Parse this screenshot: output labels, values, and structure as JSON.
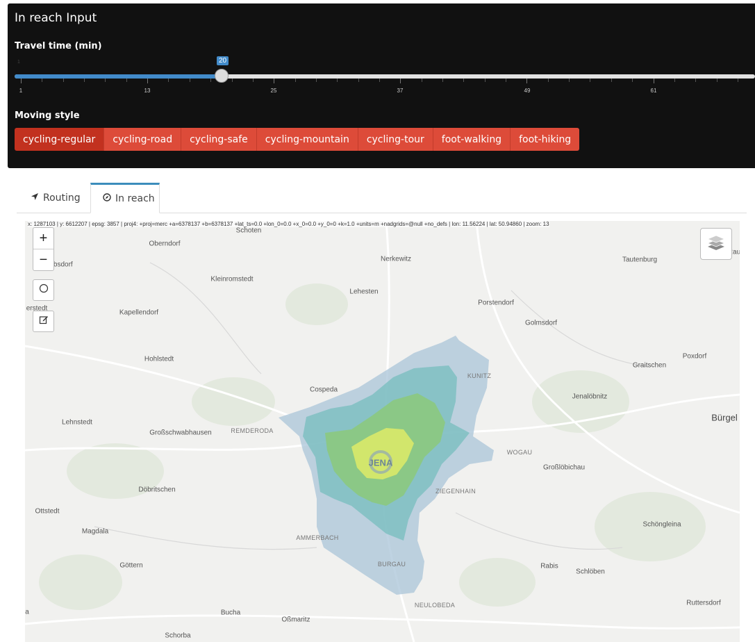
{
  "input_panel": {
    "title": "In reach Input",
    "travel_time_label": "Travel time (min)",
    "slider": {
      "min": 1,
      "value": 20,
      "min_label": "1",
      "value_label": "20",
      "tick_labels": [
        "1",
        "13",
        "25",
        "37",
        "49",
        "61"
      ]
    },
    "moving_style_label": "Moving style",
    "moving_styles": [
      {
        "label": "cycling-regular",
        "active": true
      },
      {
        "label": "cycling-road",
        "active": false
      },
      {
        "label": "cycling-safe",
        "active": false
      },
      {
        "label": "cycling-mountain",
        "active": false
      },
      {
        "label": "cycling-tour",
        "active": false
      },
      {
        "label": "foot-walking",
        "active": false
      },
      {
        "label": "foot-hiking",
        "active": false
      }
    ]
  },
  "tabs": [
    {
      "label": "Routing",
      "icon": "location-arrow-icon",
      "active": false
    },
    {
      "label": "In reach",
      "icon": "compass-icon",
      "active": true
    }
  ],
  "map": {
    "coord_readout": "x: 1287103 | y: 6612207 | epsg: 3857 | proj4: +proj=merc +a=6378137 +b=6378137 +lat_ts=0.0 +lon_0=0.0 +x_0=0.0 +y_0=0 +k=1.0 +units=m +nadgrids=@null +no_defs | lon: 11.56224 | lat: 50.94860 | zoom: 13",
    "zoom_in": "+",
    "zoom_out": "−",
    "center_label": "JENA",
    "places": {
      "schoten": "Schoten",
      "oberndorf": "Oberndorf",
      "nerkewitz": "Nerkewitz",
      "tautenburg": "Tautenburg",
      "absdorf": "absdorf",
      "kleinromstedt": "Kleinromstedt",
      "lehesten": "Lehesten",
      "porstendorf": "Porstendorf",
      "golmsdorf": "Golmsdorf",
      "erstedt": "erstedt",
      "kapellendorf": "Kapellendorf",
      "hohlstedt": "Hohlstedt",
      "kunitz": "KUNITZ",
      "graitschen": "Graitschen",
      "poxdorf": "Poxdorf",
      "cospeda": "Cospeda",
      "jenaloebnitz": "Jenalöbnitz",
      "lehnstedt": "Lehnstedt",
      "buergel": "Bürgel",
      "grossschwabhausen": "Großschwabhausen",
      "remderoda": "REMDERODA",
      "wogau": "WOGAU",
      "grossloebichau": "Großlöbichau",
      "doebritschen": "Döbritschen",
      "ziegenhain": "ZIEGENHAIN",
      "ottstedt": "Ottstedt",
      "schoengleina": "Schöngleina",
      "magdala": "Magdala",
      "ammerbach": "AMMERBACH",
      "goettern": "Göttern",
      "burgau": "BURGAU",
      "rabis": "Rabis",
      "schloeben": "Schlöben",
      "neulobeda": "NEULOBEDA",
      "ruttersdorf": "Ruttersdorf",
      "bucha": "Bucha",
      "a": "a",
      "ossmaritz": "Oßmaritz",
      "schorba": "Schorba",
      "rau": "Rau"
    },
    "isochrone_colors": [
      "#a9c4d8",
      "#7fc0c2",
      "#8cc97e",
      "#d6e86a"
    ]
  },
  "colors": {
    "accent": "#dd4b39",
    "accent_active": "#c2311f",
    "slider": "#428bca",
    "tab_accent": "#3c8dbc"
  }
}
